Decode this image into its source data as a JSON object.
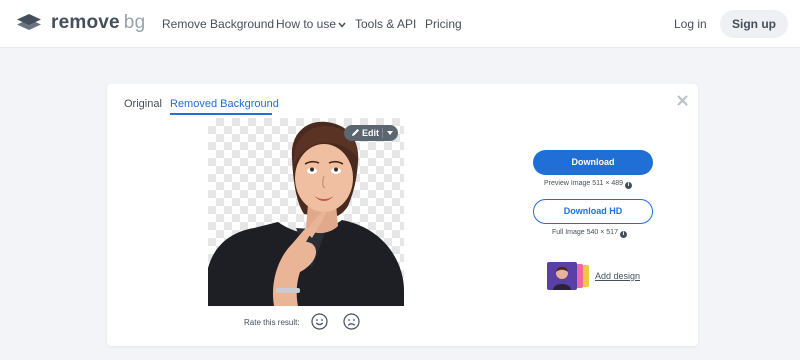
{
  "header": {
    "logo_main": "remove",
    "logo_suffix": "bg",
    "nav": [
      {
        "label": "Remove Background"
      },
      {
        "label": "How to use"
      },
      {
        "label": "Tools & API"
      },
      {
        "label": "Pricing"
      }
    ],
    "login_label": "Log in",
    "signup_label": "Sign up"
  },
  "card": {
    "tabs": [
      {
        "label": "Original",
        "active": false
      },
      {
        "label": "Removed Background",
        "active": true
      }
    ],
    "close_icon": "close-icon",
    "edit_label": "Edit",
    "rate_label": "Rate this result:",
    "download_label": "Download",
    "download_meta": "Preview Image 511 × 489",
    "download_hd_label": "Download HD",
    "download_hd_meta": "Full Image 540 × 517",
    "add_design_label": "Add design"
  },
  "colors": {
    "accent": "#1f6fd6",
    "text": "#454f5b",
    "page_bg": "#f2f4f7"
  }
}
